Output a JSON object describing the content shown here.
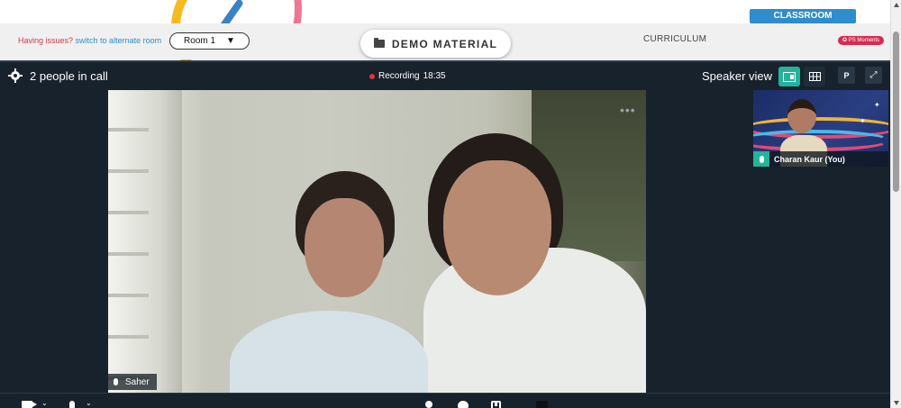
{
  "header": {
    "issues_text": "Having issues?",
    "switch_link": "switch to alternate room",
    "room_select": {
      "value": "Room 1",
      "caret": "▼"
    },
    "demo_material_label": "DEMO MATERIAL",
    "curriculum_label": "CURRICULUM",
    "classroom_label": "CLASSROOM",
    "ps_moments_label": "✪ PS Moments"
  },
  "call": {
    "people_count": "2 people in call",
    "recording_label": "Recording",
    "recording_time": "18:35",
    "view_label": "Speaker view",
    "p_button": "P",
    "expand_icon": "⤢",
    "main_participant": "Saher",
    "more_dots": "•••",
    "self_participant": "Charan Kaur (You)"
  },
  "colors": {
    "accent_teal": "#24b39b",
    "call_bg": "#17222c",
    "classroom_blue": "#2f8ccd",
    "ps_red": "#d72c4f",
    "recording_red": "#e03636"
  },
  "icons": {
    "settings": "gear-icon",
    "folder": "folder-icon",
    "speaker_view": "speaker-view-icon",
    "grid_view": "grid-view-icon",
    "camera": "camera-icon",
    "mic": "microphone-icon",
    "participants": "person-icon",
    "chat": "chat-icon",
    "share": "share-screen-icon",
    "stop": "stop-icon"
  }
}
